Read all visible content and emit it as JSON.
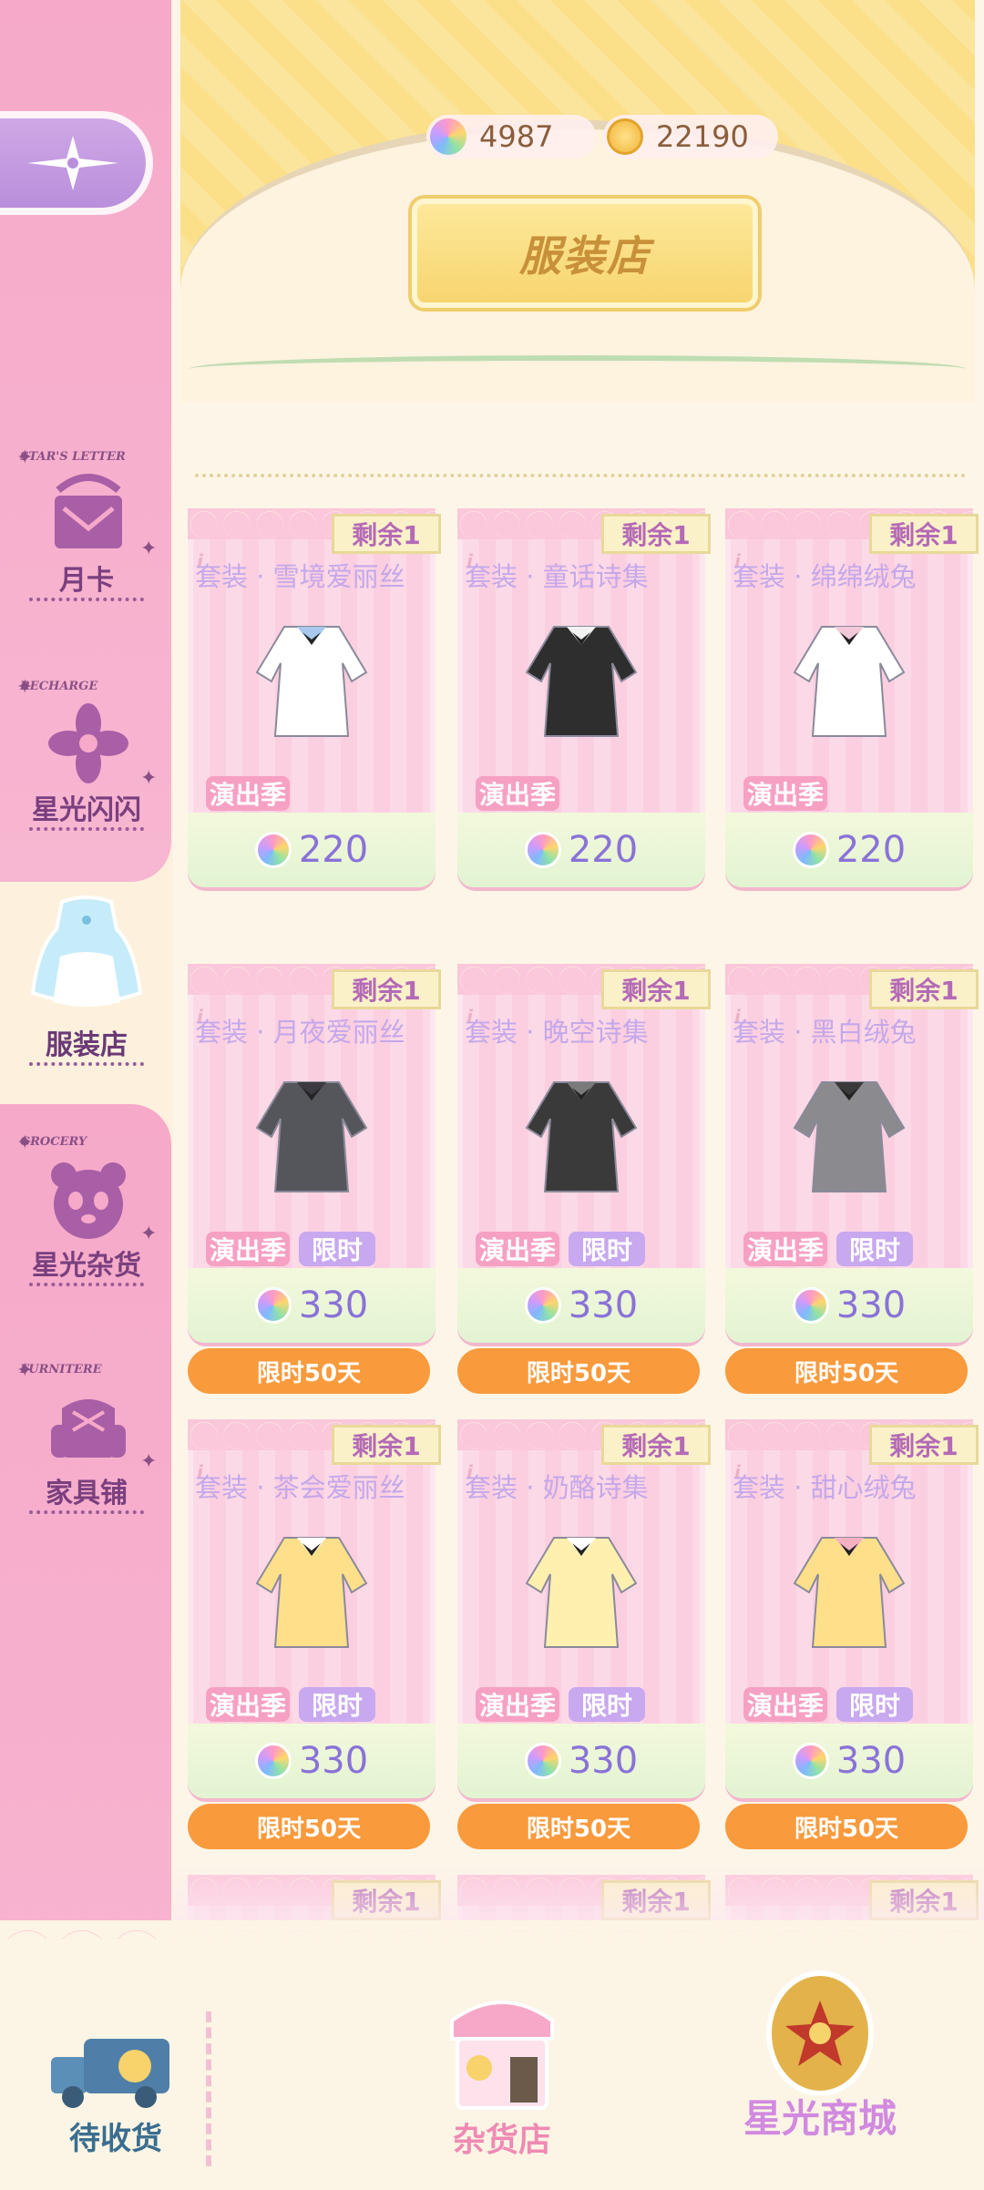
{
  "sidebar": {
    "items": [
      {
        "tag": "STAR'S LETTER",
        "label": "月卡"
      },
      {
        "tag": "RECHARGE",
        "label": "星光闪闪"
      },
      {
        "tag": "",
        "label": "服装店"
      },
      {
        "tag": "GROCERY",
        "label": "星光杂货"
      },
      {
        "tag": "FURNITERE",
        "label": "家具铺"
      }
    ]
  },
  "header": {
    "title": "服装店",
    "star_currency": "4987",
    "coin_currency": "22190"
  },
  "cards": [
    {
      "remaining": "剩余1",
      "name": "套装 · 雪境爱丽丝",
      "season": "演出季",
      "limited": "",
      "price": "220",
      "timer": ""
    },
    {
      "remaining": "剩余1",
      "name": "套装 · 童话诗集",
      "season": "演出季",
      "limited": "",
      "price": "220",
      "timer": ""
    },
    {
      "remaining": "剩余1",
      "name": "套装 · 绵绵绒兔",
      "season": "演出季",
      "limited": "",
      "price": "220",
      "timer": ""
    },
    {
      "remaining": "剩余1",
      "name": "套装 · 月夜爱丽丝",
      "season": "演出季",
      "limited": "限时",
      "price": "330",
      "timer": "限时50天"
    },
    {
      "remaining": "剩余1",
      "name": "套装 · 晚空诗集",
      "season": "演出季",
      "limited": "限时",
      "price": "330",
      "timer": "限时50天"
    },
    {
      "remaining": "剩余1",
      "name": "套装 · 黑白绒兔",
      "season": "演出季",
      "limited": "限时",
      "price": "330",
      "timer": "限时50天"
    },
    {
      "remaining": "剩余1",
      "name": "套装 · 茶会爱丽丝",
      "season": "演出季",
      "limited": "限时",
      "price": "330",
      "timer": "限时50天"
    },
    {
      "remaining": "剩余1",
      "name": "套装 · 奶酪诗集",
      "season": "演出季",
      "limited": "限时",
      "price": "330",
      "timer": "限时50天"
    },
    {
      "remaining": "剩余1",
      "name": "套装 · 甜心绒兔",
      "season": "演出季",
      "limited": "限时",
      "price": "330",
      "timer": "限时50天"
    },
    {
      "remaining": "剩余1"
    },
    {
      "remaining": "剩余1"
    },
    {
      "remaining": "剩余1"
    }
  ],
  "bottom_nav": {
    "delivery": "待收货",
    "grocery": "杂货店",
    "mall": "星光商城"
  },
  "colors": {
    "sidebar_pink": "#f6a9c9",
    "timer_orange": "#f99a3c",
    "price_purple": "#8a72d8"
  }
}
